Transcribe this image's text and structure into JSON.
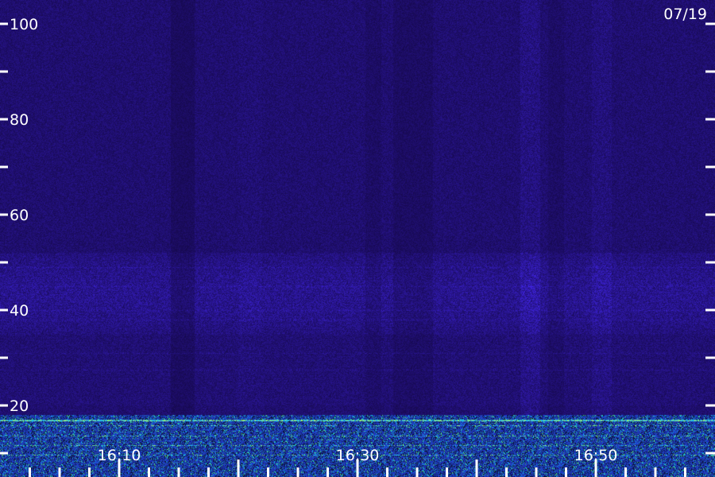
{
  "chart_data": {
    "type": "heatmap",
    "title": "",
    "date_label": "07/19",
    "xlabel": "",
    "ylabel": "",
    "x_range_minutes": [
      "16:00",
      "17:00"
    ],
    "y_range": [
      0,
      100
    ],
    "y_tick_labels": [
      {
        "value": 20,
        "text": "20"
      },
      {
        "value": 40,
        "text": "40"
      },
      {
        "value": 60,
        "text": "60"
      },
      {
        "value": 80,
        "text": "80"
      },
      {
        "value": 100,
        "text": "100"
      }
    ],
    "y_minor_ticks": [
      10,
      30,
      50,
      70,
      90
    ],
    "x_tick_labels": [
      {
        "value": "16:10",
        "text": "16:10"
      },
      {
        "value": "16:30",
        "text": "16:30"
      },
      {
        "value": "16:50",
        "text": "16:50"
      }
    ],
    "x_major_ticks": [
      "16:10",
      "16:20",
      "16:30",
      "16:40",
      "16:50",
      "17:00"
    ],
    "colors": {
      "background": "#1c0c52",
      "noise_low": "#120640",
      "noise_high": "#3a24b8",
      "band": "#2f3cd0",
      "line_cyan": "#20c0e0",
      "line_green": "#a0f080",
      "axis": "#ffffff"
    },
    "features": {
      "strong_band_hz_range": [
        0,
        18
      ],
      "strong_line_hz": 17,
      "moderate_band_hz_range": [
        35,
        52
      ],
      "faint_lines_hz": [
        27.5,
        31,
        38,
        40,
        45,
        49
      ]
    }
  }
}
